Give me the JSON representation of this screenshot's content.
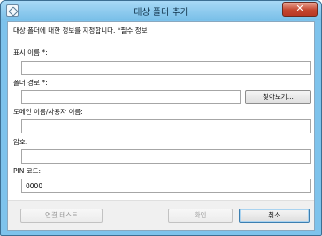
{
  "window": {
    "title": "대상 폴더 추가",
    "close_symbol": "✕"
  },
  "form": {
    "instruction": "대상 폴더에 대한 정보를 지정합니다. *필수 정보",
    "display_name": {
      "label": "표시 이름 *:",
      "value": ""
    },
    "folder_path": {
      "label": "폴더 경로 *:",
      "value": "",
      "browse_label": "찾아보기..."
    },
    "domain_user": {
      "label": "도메인 이름/사용자 이름:",
      "value": ""
    },
    "password": {
      "label": "암호:",
      "value": ""
    },
    "pin_code": {
      "label": "PIN 코드:",
      "value": "0000"
    }
  },
  "footer": {
    "test_connection_label": "연결 테스트",
    "ok_label": "확인",
    "cancel_label": "취소"
  }
}
